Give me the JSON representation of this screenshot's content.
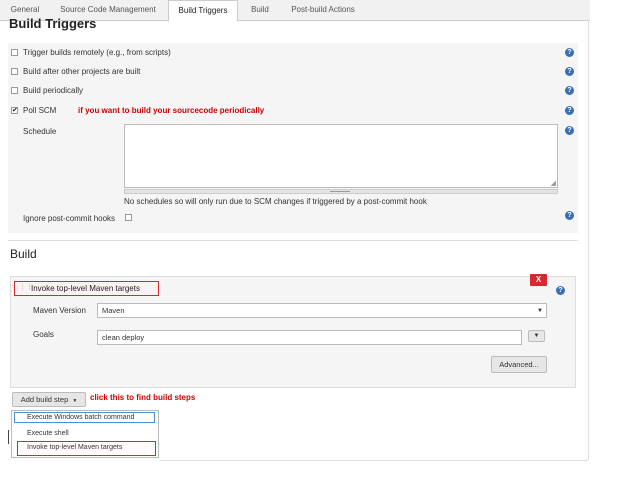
{
  "tabs": [
    "General",
    "Source Code Management",
    "Build Triggers",
    "Build",
    "Post-build Actions"
  ],
  "active_tab": "Build Triggers",
  "triggers": {
    "title": "Build Triggers",
    "options": [
      {
        "label": "Trigger builds remotely (e.g., from scripts)",
        "checked": false
      },
      {
        "label": "Build after other projects are built",
        "checked": false
      },
      {
        "label": "Build periodically",
        "checked": false
      },
      {
        "label": "Poll SCM",
        "checked": true
      }
    ],
    "poll_note": "if you want to build your sourcecode periodically",
    "schedule_label": "Schedule",
    "schedule_value": "",
    "schedule_hint": "No schedules so will only run due to SCM changes if triggered by a post-commit hook",
    "ignore_label": "Ignore post-commit hooks",
    "ignore_checked": false
  },
  "build": {
    "title": "Build",
    "step_title": "Invoke top-level Maven targets",
    "delete_label": "X",
    "maven_version_label": "Maven Version",
    "maven_version_value": "Maven",
    "goals_label": "Goals",
    "goals_value": "clean deploy",
    "advanced_label": "Advanced...",
    "add_step_label": "Add build step",
    "add_step_note": "click this to find build steps",
    "menu_items": [
      "Execute Windows batch command",
      "Execute shell",
      "Invoke top-level Maven targets"
    ]
  },
  "colors": {
    "accent_red": "#d9272e",
    "help_blue": "#3a6fb0"
  }
}
